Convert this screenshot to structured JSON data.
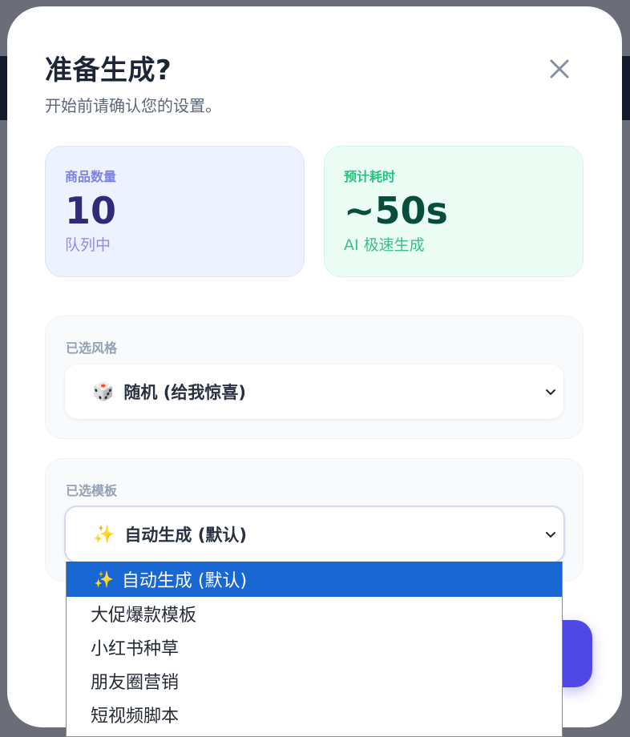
{
  "modal": {
    "title": "准备生成?",
    "subtitle": "开始前请确认您的设置。"
  },
  "stats": {
    "products": {
      "label": "商品数量",
      "value": "10",
      "note": "队列中"
    },
    "time": {
      "label": "预计耗时",
      "value": "~50s",
      "note": "AI 极速生成"
    }
  },
  "style_field": {
    "label": "已选风格",
    "emoji": "🎲",
    "selected": "随机 (给我惊喜)"
  },
  "template_field": {
    "label": "已选模板",
    "emoji": "✨",
    "selected": "自动生成 (默认)"
  },
  "dropdown": {
    "options": [
      {
        "emoji": "✨",
        "label": "自动生成 (默认)"
      },
      {
        "label": "大促爆款模板"
      },
      {
        "label": "小红书种草"
      },
      {
        "label": "朋友圈营销"
      },
      {
        "label": "短视频脚本"
      }
    ]
  },
  "icons": {
    "close": "close-icon",
    "chevron": "chevron-down-icon"
  },
  "colors": {
    "accent": "#5048e5",
    "selected_option": "#1967d2"
  }
}
